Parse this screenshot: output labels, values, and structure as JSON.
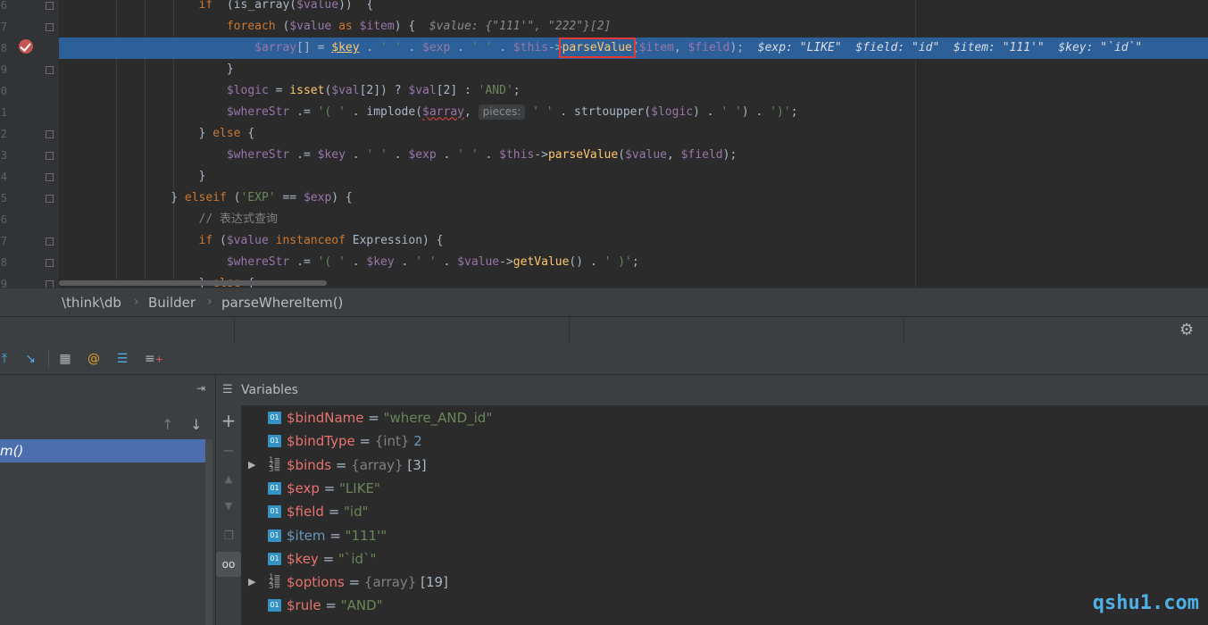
{
  "editor": {
    "gutter_numbers": [
      "6",
      "7",
      "8",
      "9",
      "0",
      "1",
      "2",
      "3",
      "4",
      "5",
      "6",
      "7",
      "8",
      "9"
    ],
    "lines": [
      {
        "indent": "          ",
        "tokens": [
          [
            "kw",
            "if"
          ],
          [
            "",
            "  (is_array("
          ],
          [
            "var",
            "$value"
          ],
          [
            "",
            "))  {"
          ]
        ]
      },
      {
        "indent": "            ",
        "tokens": [
          [
            "kw",
            "foreach"
          ],
          [
            "",
            " ("
          ],
          [
            "var",
            "$value"
          ],
          [
            "",
            " "
          ],
          [
            "kw",
            "as"
          ],
          [
            "",
            " "
          ],
          [
            "var",
            "$item"
          ],
          [
            "",
            ") {  "
          ],
          [
            "inl",
            "$value: {\"111'\", \"222\"}[2]"
          ]
        ]
      },
      {
        "indent": "              ",
        "tokens": [
          [
            "var",
            "$array"
          ],
          [
            "",
            "[] = "
          ],
          [
            "keyhl",
            "$key"
          ],
          [
            "",
            " . "
          ],
          [
            "str",
            "' '"
          ],
          [
            "",
            " . "
          ],
          [
            "var",
            "$exp"
          ],
          [
            "",
            " . "
          ],
          [
            "str",
            "' '"
          ],
          [
            "",
            " . "
          ],
          [
            "var",
            "$this"
          ],
          [
            "",
            "->"
          ],
          [
            "hl",
            "parseValue"
          ],
          [
            "",
            "("
          ],
          [
            "var",
            "$item"
          ],
          [
            "",
            ", "
          ],
          [
            "var",
            "$field"
          ],
          [
            "",
            ");  "
          ],
          [
            "inl",
            "$exp: \"LIKE\"  $field: \"id\"  $item: \"111'\"  $key: \"`id`\""
          ]
        ]
      },
      {
        "indent": "            ",
        "tokens": [
          [
            "",
            "}"
          ]
        ]
      },
      {
        "indent": "            ",
        "tokens": [
          [
            "var",
            "$logic"
          ],
          [
            "",
            " = "
          ],
          [
            "fn",
            "isset"
          ],
          [
            "",
            "("
          ],
          [
            "var",
            "$val"
          ],
          [
            "",
            "[2]) ? "
          ],
          [
            "var",
            "$val"
          ],
          [
            "",
            "[2] : "
          ],
          [
            "str",
            "'AND'"
          ],
          [
            "",
            ";"
          ]
        ]
      },
      {
        "indent": "            ",
        "tokens": [
          [
            "var",
            "$whereStr"
          ],
          [
            "",
            " .= "
          ],
          [
            "str",
            "'( '"
          ],
          [
            "",
            " . implode("
          ],
          [
            "wavyvar",
            "$array"
          ],
          [
            "",
            ", "
          ],
          [
            "hint",
            "pieces:"
          ],
          [
            "",
            " "
          ],
          [
            "str",
            "' '"
          ],
          [
            "",
            " . strtoupper("
          ],
          [
            "var",
            "$logic"
          ],
          [
            "",
            ") . "
          ],
          [
            "str",
            "' '"
          ],
          [
            "",
            ") . "
          ],
          [
            "str",
            "')'"
          ],
          [
            "",
            ";"
          ]
        ]
      },
      {
        "indent": "          ",
        "tokens": [
          [
            "",
            "} "
          ],
          [
            "kw",
            "else"
          ],
          [
            "",
            " {"
          ]
        ]
      },
      {
        "indent": "            ",
        "tokens": [
          [
            "var",
            "$whereStr"
          ],
          [
            "",
            " .= "
          ],
          [
            "var",
            "$key"
          ],
          [
            "",
            " . "
          ],
          [
            "str",
            "' '"
          ],
          [
            "",
            " . "
          ],
          [
            "var",
            "$exp"
          ],
          [
            "",
            " . "
          ],
          [
            "str",
            "' '"
          ],
          [
            "",
            " . "
          ],
          [
            "var",
            "$this"
          ],
          [
            "",
            "->"
          ],
          [
            "fn",
            "parseValue"
          ],
          [
            "",
            "("
          ],
          [
            "var",
            "$value"
          ],
          [
            "",
            ", "
          ],
          [
            "var",
            "$field"
          ],
          [
            "",
            ");"
          ]
        ]
      },
      {
        "indent": "          ",
        "tokens": [
          [
            "",
            "}"
          ]
        ]
      },
      {
        "indent": "        ",
        "tokens": [
          [
            "",
            "} "
          ],
          [
            "kw",
            "elseif"
          ],
          [
            "",
            " ("
          ],
          [
            "str",
            "'EXP'"
          ],
          [
            "",
            " == "
          ],
          [
            "var",
            "$exp"
          ],
          [
            "",
            ") {"
          ]
        ]
      },
      {
        "indent": "          ",
        "tokens": [
          [
            "cmt",
            "// 表达式查询"
          ]
        ]
      },
      {
        "indent": "          ",
        "tokens": [
          [
            "kw",
            "if"
          ],
          [
            "",
            " ("
          ],
          [
            "var",
            "$value"
          ],
          [
            "",
            " "
          ],
          [
            "kw",
            "instanceof"
          ],
          [
            "",
            " Expression) {"
          ]
        ]
      },
      {
        "indent": "            ",
        "tokens": [
          [
            "var",
            "$whereStr"
          ],
          [
            "",
            " .= "
          ],
          [
            "str",
            "'( '"
          ],
          [
            "",
            " . "
          ],
          [
            "var",
            "$key"
          ],
          [
            "",
            " . "
          ],
          [
            "str",
            "' '"
          ],
          [
            "",
            " . "
          ],
          [
            "var",
            "$value"
          ],
          [
            "",
            "->"
          ],
          [
            "fn",
            "getValue"
          ],
          [
            "",
            "() . "
          ],
          [
            "str",
            "' )'"
          ],
          [
            "",
            ";"
          ]
        ]
      },
      {
        "indent": "          ",
        "tokens": [
          [
            "",
            "} "
          ],
          [
            "kw",
            "else"
          ],
          [
            "",
            " {"
          ]
        ]
      }
    ]
  },
  "breadcrumb": [
    "\\think\\db",
    "Builder",
    "parseWhereItem()"
  ],
  "frames": {
    "selected_frame": "m()"
  },
  "variables": {
    "title": "Variables",
    "rows": [
      {
        "expandable": false,
        "icon": "01",
        "name": "$bindName",
        "type": "",
        "value": "\"where_AND_id\"",
        "vkind": "s"
      },
      {
        "expandable": false,
        "icon": "01",
        "name": "$bindType",
        "type": "{int}",
        "value": "2",
        "vkind": "n"
      },
      {
        "expandable": true,
        "icon": "arr",
        "name": "$binds",
        "type": "{array}",
        "value": "[3]",
        "vkind": ""
      },
      {
        "expandable": false,
        "icon": "01",
        "name": "$exp",
        "type": "",
        "value": "\"LIKE\"",
        "vkind": "s"
      },
      {
        "expandable": false,
        "icon": "01",
        "name": "$field",
        "type": "",
        "value": "\"id\"",
        "vkind": "s"
      },
      {
        "expandable": false,
        "icon": "01",
        "name": "$item",
        "type": "",
        "value": "\"111'\"",
        "vkind": "s",
        "highlight": true
      },
      {
        "expandable": false,
        "icon": "01",
        "name": "$key",
        "type": "",
        "value": "\"`id`\"",
        "vkind": "s"
      },
      {
        "expandable": true,
        "icon": "arr",
        "name": "$options",
        "type": "{array}",
        "value": "[19]",
        "vkind": ""
      },
      {
        "expandable": false,
        "icon": "01",
        "name": "$rule",
        "type": "",
        "value": "\"AND\"",
        "vkind": "s"
      }
    ]
  },
  "watermark": "qshu1.com",
  "colors": {
    "accent": "#2d6099",
    "selection": "#4b6eaf",
    "breakpoint": "#c75450",
    "highlight_box": "#e53935"
  }
}
